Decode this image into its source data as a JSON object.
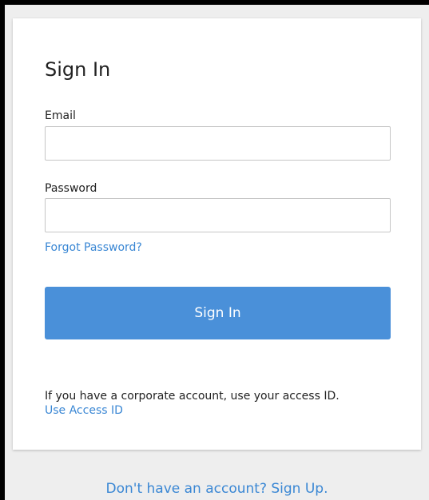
{
  "signin_card": {
    "title": "Sign In",
    "email": {
      "label": "Email",
      "value": "",
      "placeholder": ""
    },
    "password": {
      "label": "Password",
      "value": "",
      "placeholder": ""
    },
    "forgot_password_link": "Forgot Password?",
    "submit_button": "Sign In",
    "corporate_notice": "If you have a corporate account, use your access ID.",
    "access_id_link": "Use Access ID"
  },
  "footer": {
    "signup_link": "Don't have an account? Sign Up."
  },
  "colors": {
    "accent": "#4a90d9",
    "link": "#3a87d4",
    "page_background": "#eeeeee",
    "card_background": "#ffffff"
  }
}
